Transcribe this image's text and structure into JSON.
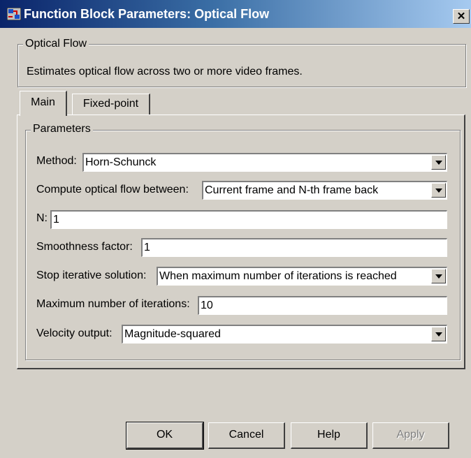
{
  "window": {
    "title": "Function Block Parameters: Optical Flow",
    "close_glyph": "✕",
    "icon": "simulink-block-icon"
  },
  "block": {
    "group_label": "Optical Flow",
    "description": "Estimates optical flow across two or more video frames."
  },
  "tabs": [
    {
      "label": "Main",
      "selected": true
    },
    {
      "label": "Fixed-point",
      "selected": false
    }
  ],
  "parameters": {
    "group_label": "Parameters",
    "method": {
      "label": "Method:",
      "value": "Horn-Schunck"
    },
    "compute_between": {
      "label": "Compute optical flow between:",
      "value": "Current frame and N-th frame back"
    },
    "n": {
      "label": "N:",
      "value": "1"
    },
    "smoothness": {
      "label": "Smoothness factor:",
      "value": "1"
    },
    "stop_solution": {
      "label": "Stop iterative solution:",
      "value": "When maximum number of iterations is reached"
    },
    "max_iterations": {
      "label": "Maximum number of iterations:",
      "value": "10"
    },
    "velocity_output": {
      "label": "Velocity output:",
      "value": "Magnitude-squared"
    }
  },
  "buttons": {
    "ok": "OK",
    "cancel": "Cancel",
    "help": "Help",
    "apply": "Apply"
  }
}
